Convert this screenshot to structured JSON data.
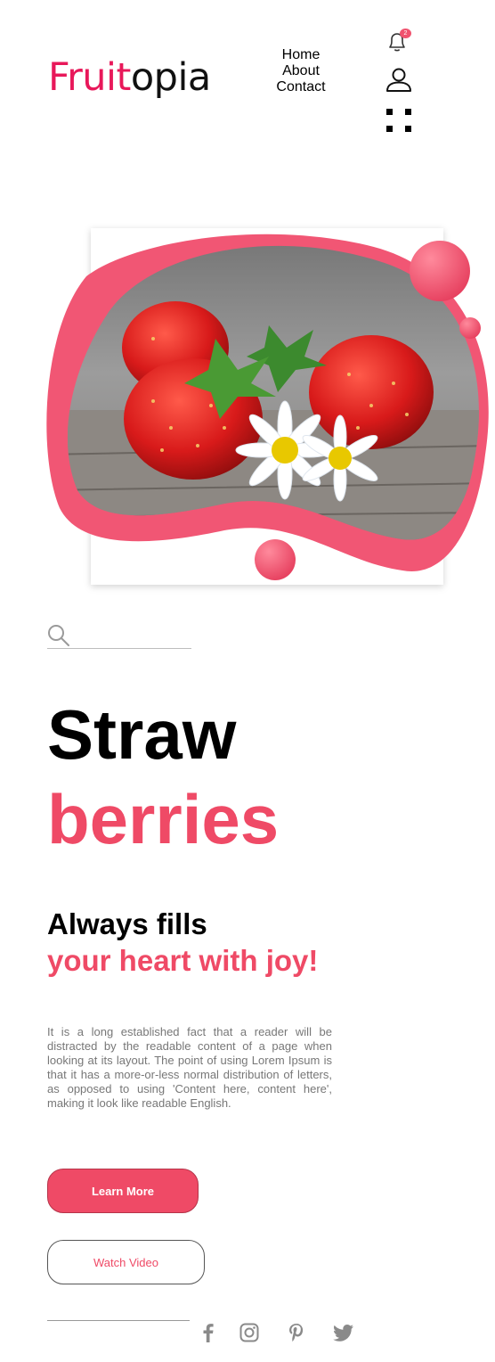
{
  "brand": {
    "logo_part1": "Fruit",
    "logo_part2": "opia"
  },
  "nav": {
    "items": [
      "Home",
      "About",
      "Contact"
    ]
  },
  "header_icons": {
    "bell": "bell-icon",
    "bell_badge": "2",
    "user": "user-icon",
    "menu": "grid-menu-icon"
  },
  "search": {
    "placeholder": ""
  },
  "hero": {
    "title_line1": "Straw",
    "title_line2": "berries",
    "subtitle_line1": "Always fills",
    "subtitle_line2": "your heart with joy!",
    "description": "It is a long established fact that a reader will be distracted by the readable content of a page when looking at its layout. The point of using Lorem Ipsum is that it has a more-or-less normal distribution of letters, as opposed to using 'Content here, content here', making it look like readable English."
  },
  "buttons": {
    "primary": "Learn More",
    "secondary": "Watch Video"
  },
  "social": [
    "facebook-icon",
    "instagram-icon",
    "pinterest-icon",
    "twitter-icon"
  ],
  "colors": {
    "accent": "#ef4a66",
    "logo_accent": "#e8185a",
    "text": "#000000",
    "muted": "#777777"
  }
}
